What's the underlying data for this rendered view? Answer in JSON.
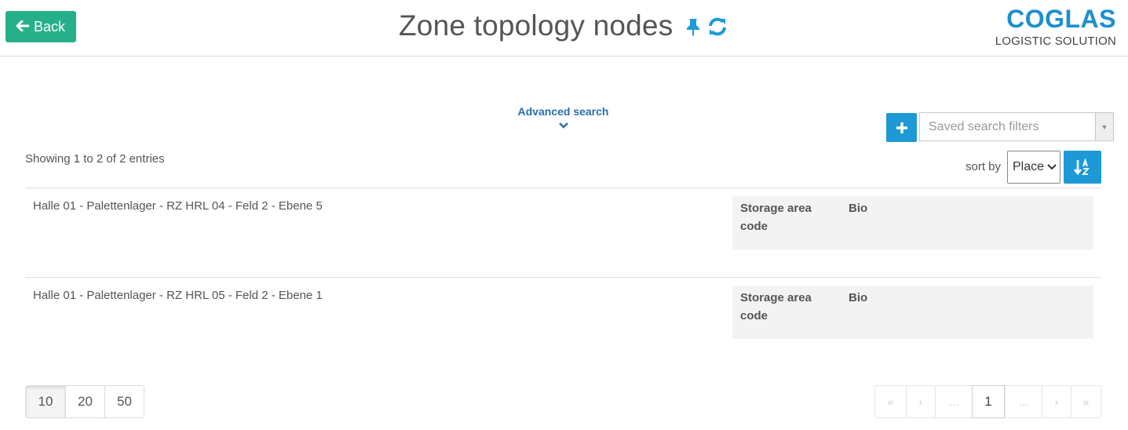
{
  "header": {
    "back_label": "Back",
    "title": "Zone topology nodes",
    "logo_main": "COGLAS",
    "logo_sub": "LOGISTIC SOLUTION"
  },
  "search": {
    "advanced_label": "Advanced search",
    "saved_filters_placeholder": "Saved search filters"
  },
  "summary": {
    "showing": "Showing 1 to 2 of 2 entries"
  },
  "sort": {
    "label": "sort by",
    "selected": "Place"
  },
  "rows": [
    {
      "title": "Halle 01 - Palettenlager - RZ HRL 04 - Feld 2 - Ebene 5",
      "attr_key": "Storage area code",
      "attr_value": "Bio"
    },
    {
      "title": "Halle 01 - Palettenlager - RZ HRL 05 - Feld 2 - Ebene 1",
      "attr_key": "Storage area code",
      "attr_value": "Bio"
    }
  ],
  "page_size": [
    "10",
    "20",
    "50"
  ],
  "pagination": [
    "«",
    "‹",
    "…",
    "1",
    "…",
    "›",
    "»"
  ],
  "colors": {
    "back_button": "#26b08a",
    "accent_blue": "#1d9ad6",
    "logo_blue": "#1d8fcf",
    "link_blue": "#2a6fae"
  },
  "icons": {
    "back": "arrow-left-icon",
    "pin": "pin-icon",
    "refresh": "refresh-icon",
    "add": "plus-icon",
    "sort_direction": "sort-alpha-icon",
    "expand": "chevron-down-icon"
  }
}
